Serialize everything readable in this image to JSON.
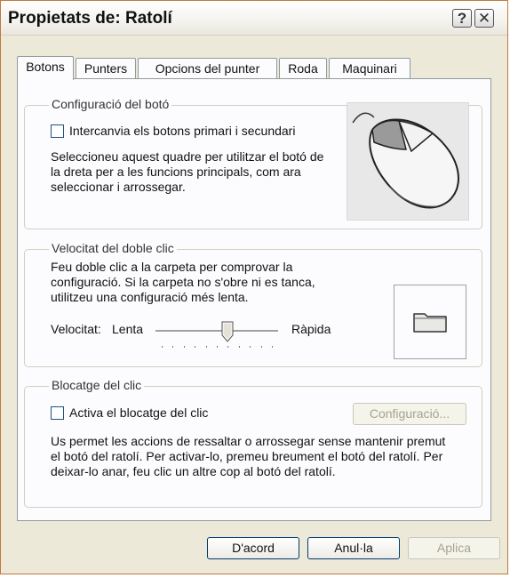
{
  "window": {
    "title": "Propietats de: Ratolí",
    "help_glyph": "?",
    "close_glyph": "✕"
  },
  "tabs": [
    {
      "label": "Botons",
      "active": true
    },
    {
      "label": "Punters",
      "active": false
    },
    {
      "label": "Opcions del punter",
      "active": false
    },
    {
      "label": "Roda",
      "active": false
    },
    {
      "label": "Maquinari",
      "active": false
    }
  ],
  "button_config": {
    "legend": "Configuració del botó",
    "checkbox_label": "Intercanvia els botons primari i secundari",
    "checked": false,
    "description": [
      "Seleccioneu aquest quadre per utilitzar el botó de",
      "la dreta per a les funcions principals, com ara",
      "seleccionar i arrossegar."
    ]
  },
  "double_click": {
    "legend": "Velocitat del doble clic",
    "description": [
      "Feu doble clic a la carpeta per comprovar la",
      "configuració. Si la carpeta no s'obre ni es tanca,",
      "utilitzeu una configuració més lenta."
    ],
    "speed_label": "Velocitat:",
    "slow_label": "Lenta",
    "fast_label": "Ràpida",
    "speed_fraction": 0.6
  },
  "click_lock": {
    "legend": "Blocatge del clic",
    "checkbox_label": "Activa el blocatge del clic",
    "checked": false,
    "settings_button": "Configuració...",
    "description": [
      "Us permet les accions de ressaltar o arrossegar sense mantenir premut",
      "el botó del ratolí. Per activar-lo, premeu breument el botó del ratolí. Per",
      "deixar-lo anar, feu clic un altre cop al botó del ratolí."
    ]
  },
  "footer": {
    "ok": "D'acord",
    "cancel": "Anul·la",
    "apply": "Aplica"
  },
  "colors": {
    "titlebar": "#f4f3ee",
    "dialog": "#ece9d8",
    "panel": "#fcfcfe",
    "border": "#c07a3a"
  }
}
